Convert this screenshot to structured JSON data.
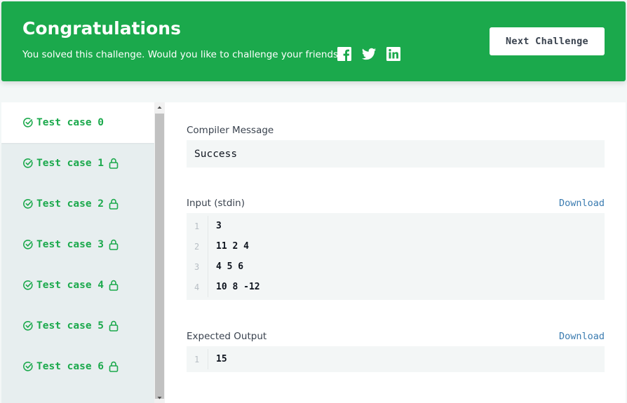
{
  "banner": {
    "title": "Congratulations",
    "subtitle": "You solved this challenge. Would you like to challenge your friends?",
    "next_button": "Next Challenge",
    "social": [
      "facebook-icon",
      "twitter-icon",
      "linkedin-icon"
    ],
    "bg_color": "#1ba94c"
  },
  "test_cases": [
    {
      "label": "Test case 0",
      "passed": true,
      "locked": false,
      "active": true
    },
    {
      "label": "Test case 1",
      "passed": true,
      "locked": true,
      "active": false
    },
    {
      "label": "Test case 2",
      "passed": true,
      "locked": true,
      "active": false
    },
    {
      "label": "Test case 3",
      "passed": true,
      "locked": true,
      "active": false
    },
    {
      "label": "Test case 4",
      "passed": true,
      "locked": true,
      "active": false
    },
    {
      "label": "Test case 5",
      "passed": true,
      "locked": true,
      "active": false
    },
    {
      "label": "Test case 6",
      "passed": true,
      "locked": true,
      "active": false
    }
  ],
  "compiler": {
    "label": "Compiler Message",
    "message": "Success"
  },
  "input": {
    "label": "Input (stdin)",
    "download": "Download",
    "lines": [
      {
        "no": "1",
        "text": "3"
      },
      {
        "no": "2",
        "text": "11 2 4"
      },
      {
        "no": "3",
        "text": "4 5 6"
      },
      {
        "no": "4",
        "text": "10 8 -12"
      }
    ]
  },
  "expected": {
    "label": "Expected Output",
    "download": "Download",
    "lines": [
      {
        "no": "1",
        "text": "15"
      }
    ]
  },
  "colors": {
    "accent": "#1ba94c",
    "link": "#3a7bb0"
  }
}
